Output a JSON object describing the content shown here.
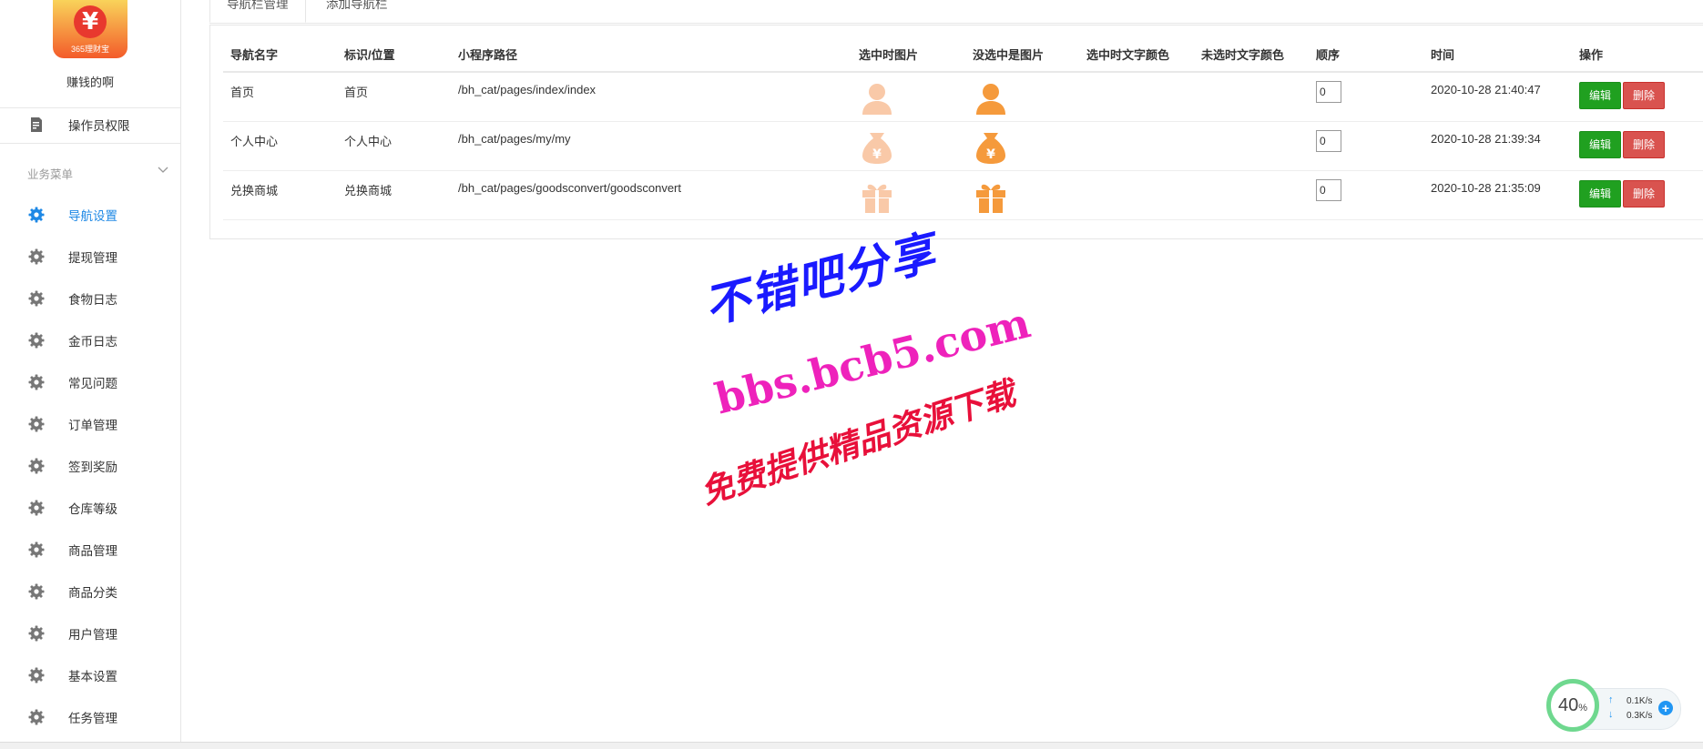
{
  "sidebar": {
    "logo_caption": "365理财宝",
    "shop_name": "赚钱的啊",
    "permission_item": "操作员权限",
    "group_title": "业务菜单",
    "items": [
      {
        "label": "导航设置",
        "active": true
      },
      {
        "label": "提现管理"
      },
      {
        "label": "食物日志"
      },
      {
        "label": "金币日志"
      },
      {
        "label": "常见问题"
      },
      {
        "label": "订单管理"
      },
      {
        "label": "签到奖励"
      },
      {
        "label": "仓库等级"
      },
      {
        "label": "商品管理"
      },
      {
        "label": "商品分类"
      },
      {
        "label": "用户管理"
      },
      {
        "label": "基本设置"
      },
      {
        "label": "任务管理"
      }
    ]
  },
  "tabs": [
    "导航栏管理",
    "添加导航栏"
  ],
  "table": {
    "headers": [
      "导航名字",
      "标识/位置",
      "小程序路径",
      "选中时图片",
      "没选中是图片",
      "选中时文字颜色",
      "未选时文字颜色",
      "顺序",
      "时间",
      "操作"
    ],
    "rows": [
      {
        "name": "首页",
        "position": "首页",
        "path": "/bh_cat/pages/index/index",
        "icon": "person-icon",
        "order": "0",
        "time": "2020-10-28 21:40:47"
      },
      {
        "name": "个人中心",
        "position": "个人中心",
        "path": "/bh_cat/pages/my/my",
        "icon": "money-bag-icon",
        "order": "0",
        "time": "2020-10-28 21:39:34"
      },
      {
        "name": "兑换商城",
        "position": "兑换商城",
        "path": "/bh_cat/pages/goodsconvert/goodsconvert",
        "icon": "gift-icon",
        "order": "0",
        "time": "2020-10-28 21:35:09"
      }
    ],
    "edit_label": "编辑",
    "delete_label": "删除"
  },
  "watermark": {
    "line1": "不错吧分享",
    "line2": "bbs.bcb5.com",
    "line3": "免费提供精品资源下载"
  },
  "speed_widget": {
    "percent": "40",
    "percent_unit": "%",
    "up": "0.1K/s",
    "down": "0.3K/s"
  },
  "colors": {
    "active": "#1e88e5",
    "edit_button": "#20a020",
    "delete_button": "#d9534f",
    "icon_selected_light": "#f9c9a8",
    "icon_unselected": "#f59a3c"
  }
}
